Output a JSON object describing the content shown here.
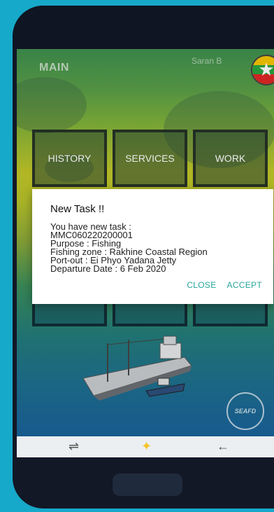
{
  "header": {
    "title": "MAIN",
    "user": "Saran B",
    "flag_icon": "myanmar-flag-icon"
  },
  "menu": {
    "items": [
      {
        "label": "HISTORY"
      },
      {
        "label": "SERVICES"
      },
      {
        "label": "WORK"
      }
    ]
  },
  "dialog": {
    "title": "New Task !!",
    "lines": [
      "You have new task :",
      "MMC060220200001",
      "Purpose : Fishing",
      "Fishing zone : Rakhine Coastal Region",
      "Port-out : Ei Phyo Yadana Jetty",
      "Departure Date : 6 Feb 2020"
    ],
    "close_label": "CLOSE",
    "accept_label": "ACCEPT"
  },
  "navbar": {
    "recent": "⇌",
    "home": "✦",
    "back": "←"
  },
  "logo_text": "SEAFD",
  "colors": {
    "accent": "#26a69a",
    "background": "#17a9c9",
    "home_star": "#f6c325"
  }
}
